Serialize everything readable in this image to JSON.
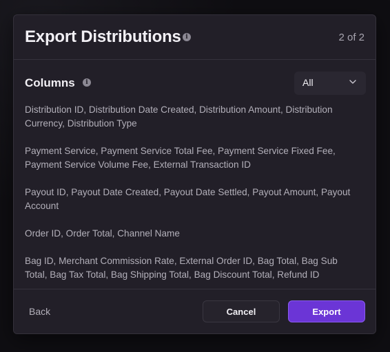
{
  "dialog": {
    "title": "Export Distributions",
    "step": "2 of 2"
  },
  "columns": {
    "label": "Columns",
    "filter_value": "All",
    "groups": [
      "Distribution ID, Distribution Date Created, Distribution Amount, Distribution Currency, Distribution Type",
      "Payment Service, Payment Service Total Fee, Payment Service Fixed Fee, Payment Service Volume Fee, External Transaction ID",
      "Payout ID, Payout Date Created, Payout Date Settled, Payout Amount, Payout Account",
      "Order ID, Order Total, Channel Name",
      "Bag ID, Merchant Commission Rate, External Order ID, Bag Total, Bag Sub Total, Bag Tax Total, Bag Shipping Total, Bag Discount Total, Refund ID"
    ]
  },
  "footer": {
    "back_label": "Back",
    "cancel_label": "Cancel",
    "export_label": "Export"
  },
  "colors": {
    "accent": "#6b35d6",
    "surface": "#221f28"
  },
  "icons": {
    "info": "info-icon",
    "dropdown": "chevron-down-icon"
  }
}
